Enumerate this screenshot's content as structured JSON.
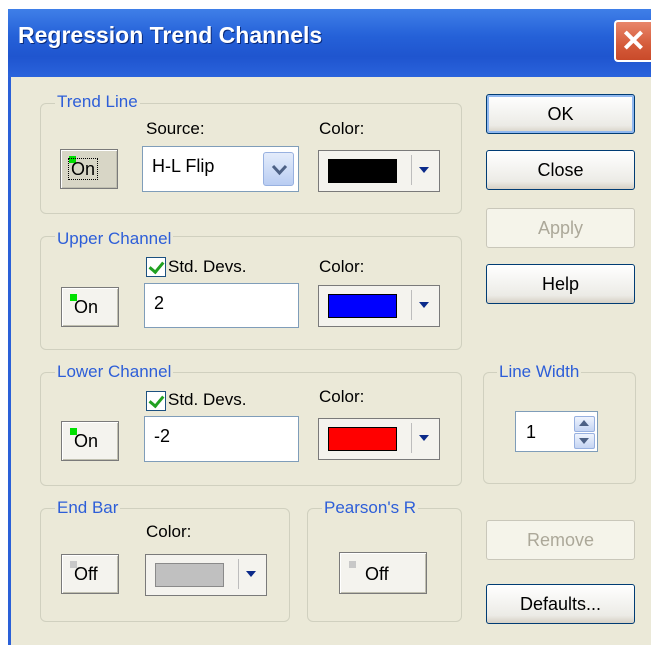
{
  "window": {
    "title": "Regression Trend Channels",
    "close_glyph": "✕"
  },
  "trend_line": {
    "legend": "Trend Line",
    "toggle_label": "On",
    "source_label": "Source:",
    "source_value": "H-L Flip",
    "color_label": "Color:",
    "color": "#000000"
  },
  "upper_channel": {
    "legend": "Upper Channel",
    "toggle_label": "On",
    "std_devs_label": "Std. Devs.",
    "std_devs_checked": true,
    "std_devs_value": "2",
    "color_label": "Color:",
    "color": "#0000ff"
  },
  "lower_channel": {
    "legend": "Lower Channel",
    "toggle_label": "On",
    "std_devs_label": "Std. Devs.",
    "std_devs_checked": true,
    "std_devs_value": "-2",
    "color_label": "Color:",
    "color": "#ff0000"
  },
  "end_bar": {
    "legend": "End Bar",
    "toggle_label": "Off",
    "color_label": "Color:",
    "color": "#c0c0c0"
  },
  "pearsons_r": {
    "legend": "Pearson's R",
    "toggle_label": "Off"
  },
  "line_width": {
    "legend": "Line Width",
    "value": "1"
  },
  "buttons": {
    "ok": "OK",
    "close": "Close",
    "apply": "Apply",
    "help": "Help",
    "remove": "Remove",
    "defaults": "Defaults..."
  },
  "colors": {
    "led_on": "#00e000",
    "led_off": "#c8c8c8",
    "accent": "#2d5ed8"
  }
}
